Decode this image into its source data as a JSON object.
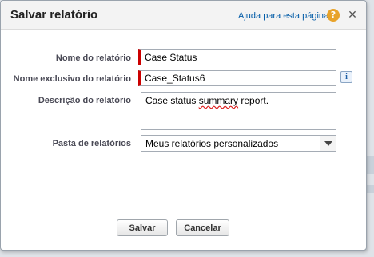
{
  "dialog": {
    "title": "Salvar relatório",
    "help_link": "Ajuda para esta página",
    "help_icon": "?",
    "close_icon": "✕"
  },
  "form": {
    "report_name_label": "Nome do relatório",
    "report_name_value": "Case Status",
    "unique_name_label": "Nome exclusivo do relatório",
    "unique_name_value": "Case_Status6",
    "info_icon": "i",
    "description_label": "Descrição do relatório",
    "description_before": "Case status ",
    "description_misspelled": "summary",
    "description_after": " report.",
    "folder_label": "Pasta de relatórios",
    "folder_value": "Meus relatórios personalizados"
  },
  "buttons": {
    "save": "Salvar",
    "cancel": "Cancelar"
  },
  "colors": {
    "required_marker": "#cc0000",
    "link": "#015ba7",
    "help_icon": "#e8a32a"
  }
}
